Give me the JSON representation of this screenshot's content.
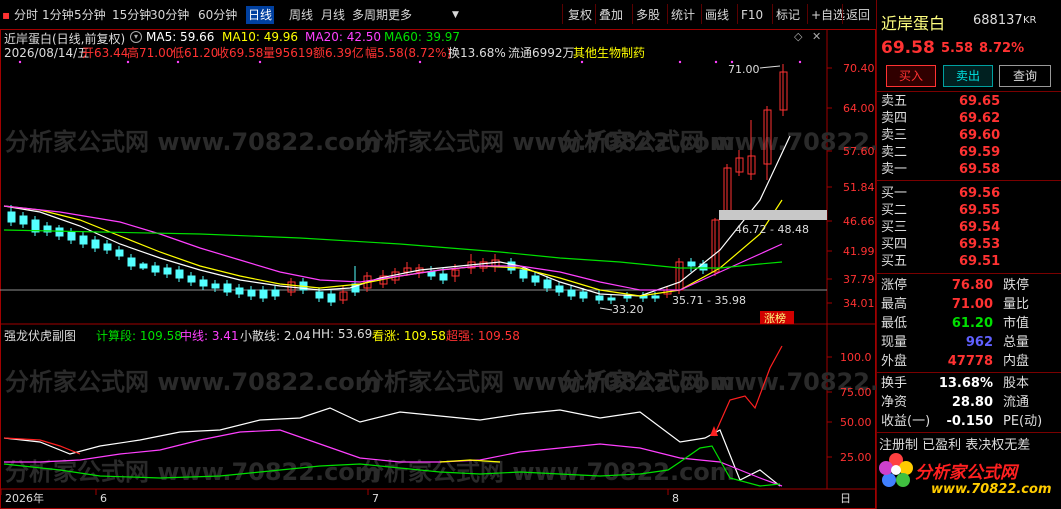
{
  "toolbar": {
    "periods": [
      "分时",
      "1分钟",
      "5分钟",
      "15分钟",
      "30分钟",
      "60分钟",
      "日线",
      "周线",
      "月线",
      "多周期",
      "更多"
    ],
    "active": "日线",
    "tools": [
      "复权",
      "叠加",
      "多股",
      "统计",
      "画线",
      "F10",
      "标记",
      "+自选",
      "返回"
    ]
  },
  "header": {
    "title": "近岸蛋白(日线,前复权)",
    "ma5": "MA5: 59.66",
    "ma10": "MA10: 49.96",
    "ma20": "MA20: 42.50",
    "ma60": "MA60: 39.97",
    "date": "2026/08/14/五",
    "open": "开63.44",
    "high": "高71.00",
    "low": "低61.20",
    "close": "收69.58",
    "volume": "量95619",
    "amount": "额6.39亿",
    "change": "幅5.58(8.72%)",
    "turnover": "换13.68%",
    "float": "流通6992万",
    "sector": "其他生物制药"
  },
  "main_chart": {
    "y_ticks": [
      "70.40",
      "64.00",
      "57.60",
      "51.84",
      "46.66",
      "41.99",
      "37.79",
      "34.01"
    ],
    "ann_high": "71.00",
    "ann_low": "33.20",
    "ann_range1": "46.72 - 48.48",
    "ann_range2": "35.71 - 35.98",
    "badge": "涨榜"
  },
  "sub_chart": {
    "title": "强龙伏虎副图",
    "calc": "计算段: 109.58",
    "mid": "中线: 3.41",
    "small": "小散线: 2.04",
    "hh": "HH: 53.69",
    "up": "看涨: 109.58",
    "super": "超强: 109.58",
    "y_ticks": [
      "100.0",
      "75.00",
      "50.00",
      "25.00"
    ]
  },
  "x_axis": {
    "labels": [
      "2026年",
      "6",
      "7",
      "8"
    ],
    "corner": "日"
  },
  "watermark": "分析家公式网 www.70822.com",
  "right_panel": {
    "name": "近岸蛋白",
    "code": "688137",
    "kr": "KR",
    "price": "69.58",
    "change": "5.58",
    "pct": "8.72%",
    "buy_btn": "买入",
    "sell_btn": "卖出",
    "query_btn": "查询",
    "asks": [
      {
        "label": "卖五",
        "price": "69.65"
      },
      {
        "label": "卖四",
        "price": "69.62"
      },
      {
        "label": "卖三",
        "price": "69.60"
      },
      {
        "label": "卖二",
        "price": "69.59"
      },
      {
        "label": "卖一",
        "price": "69.58"
      }
    ],
    "bids": [
      {
        "label": "买一",
        "price": "69.56"
      },
      {
        "label": "买二",
        "price": "69.55"
      },
      {
        "label": "买三",
        "price": "69.54"
      },
      {
        "label": "买四",
        "price": "69.53"
      },
      {
        "label": "买五",
        "price": "69.51"
      }
    ],
    "stats": [
      {
        "l1": "涨停",
        "v": "76.80",
        "c": "red",
        "l2": "跌停"
      },
      {
        "l1": "最高",
        "v": "71.00",
        "c": "red",
        "l2": "量比"
      },
      {
        "l1": "最低",
        "v": "61.20",
        "c": "green",
        "l2": "市值"
      },
      {
        "l1": "现量",
        "v": "962",
        "c": "blue",
        "l2": "总量"
      },
      {
        "l1": "外盘",
        "v": "47778",
        "c": "red",
        "l2": "内盘"
      }
    ],
    "stats2": [
      {
        "l1": "换手",
        "v": "13.68%",
        "l2": "股本"
      },
      {
        "l1": "净资",
        "v": "28.80",
        "l2": "流通"
      },
      {
        "l1": "收益(一)",
        "v": "-0.150",
        "l2": "PE(动)"
      }
    ],
    "notice": "注册制 已盈利 表决权无差",
    "logo_text": "分析家公式网",
    "logo_url": "www.70822.com"
  }
}
